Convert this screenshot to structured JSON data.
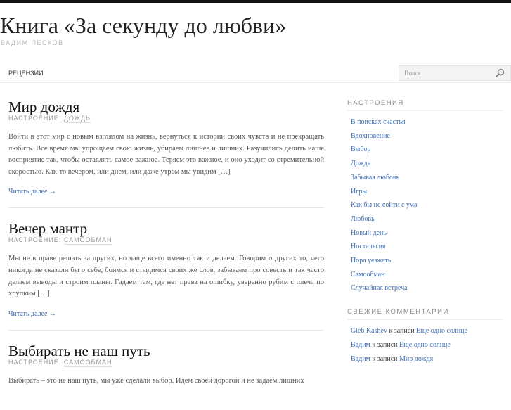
{
  "site": {
    "title": "Книга «За секунду до любви»",
    "description": "ВАДИМ ПЕСКОВ"
  },
  "nav": {
    "items": [
      {
        "label": "РЕЦЕНЗИИ"
      }
    ],
    "search_placeholder": "Поиск"
  },
  "posts": [
    {
      "title": "Мир дождя",
      "meta_label": "НАСТРОЕНИЕ:",
      "category": "ДОЖДЬ",
      "excerpt": "Войти в этот мир с новым взглядом на жизнь, вернуться к истории своих чувств и не прекращать любить. Все время мы упрощаем свою жизнь, убираем лишнее и лишних. Разучились делить наше восприятие так, чтобы оставлять самое важное. Теряем это важное, и оно уходит со стремительной скоростью. Как-то вечером, или днем, или даже утром мы увидим […]",
      "more": "Читать далее →"
    },
    {
      "title": "Вечер мантр",
      "meta_label": "НАСТРОЕНИЕ:",
      "category": "САМООБМАН",
      "excerpt": "Мы не в праве решать за других, но чаще всего именно так и делаем. Говорим о других то, чего никогда не сказали бы о себе, боимся и стыдимся своих же слов, забываем про совесть и так часто делаем выводы и строим планы. Гадаем там, где нет права на ошибку, уверенно рубим с плеча по хрупким […]",
      "more": "Читать далее →"
    },
    {
      "title": "Выбирать не наш путь",
      "meta_label": "НАСТРОЕНИЕ:",
      "category": "САМООБМАН",
      "excerpt": "Выбирать – это не наш путь, мы уже сделали выбор. Идем своей дорогой и не задаем лишних"
    }
  ],
  "sidebar": {
    "moods_title": "НАСТРОЕНИЯ",
    "moods": [
      "В поисках счастья",
      "Вдохновение",
      "Выбор",
      "Дождь",
      "Забывая любовь",
      "Игры",
      "Как бы не сойти с ума",
      "Любовь",
      "Новый день",
      "Ностальгия",
      "Пора уезжать",
      "Самообман",
      "Случайная встреча"
    ],
    "comments_title": "СВЕЖИЕ КОММЕНТАРИИ",
    "comments": [
      {
        "author": "Gleb Kashev",
        "connector": " к записи ",
        "post": "Еще одно солнце"
      },
      {
        "author": "Вадим",
        "connector": " к записи ",
        "post": "Еще одно солнце"
      },
      {
        "author": "Вадим",
        "connector": " к записи ",
        "post": "Мир дождя"
      }
    ]
  }
}
